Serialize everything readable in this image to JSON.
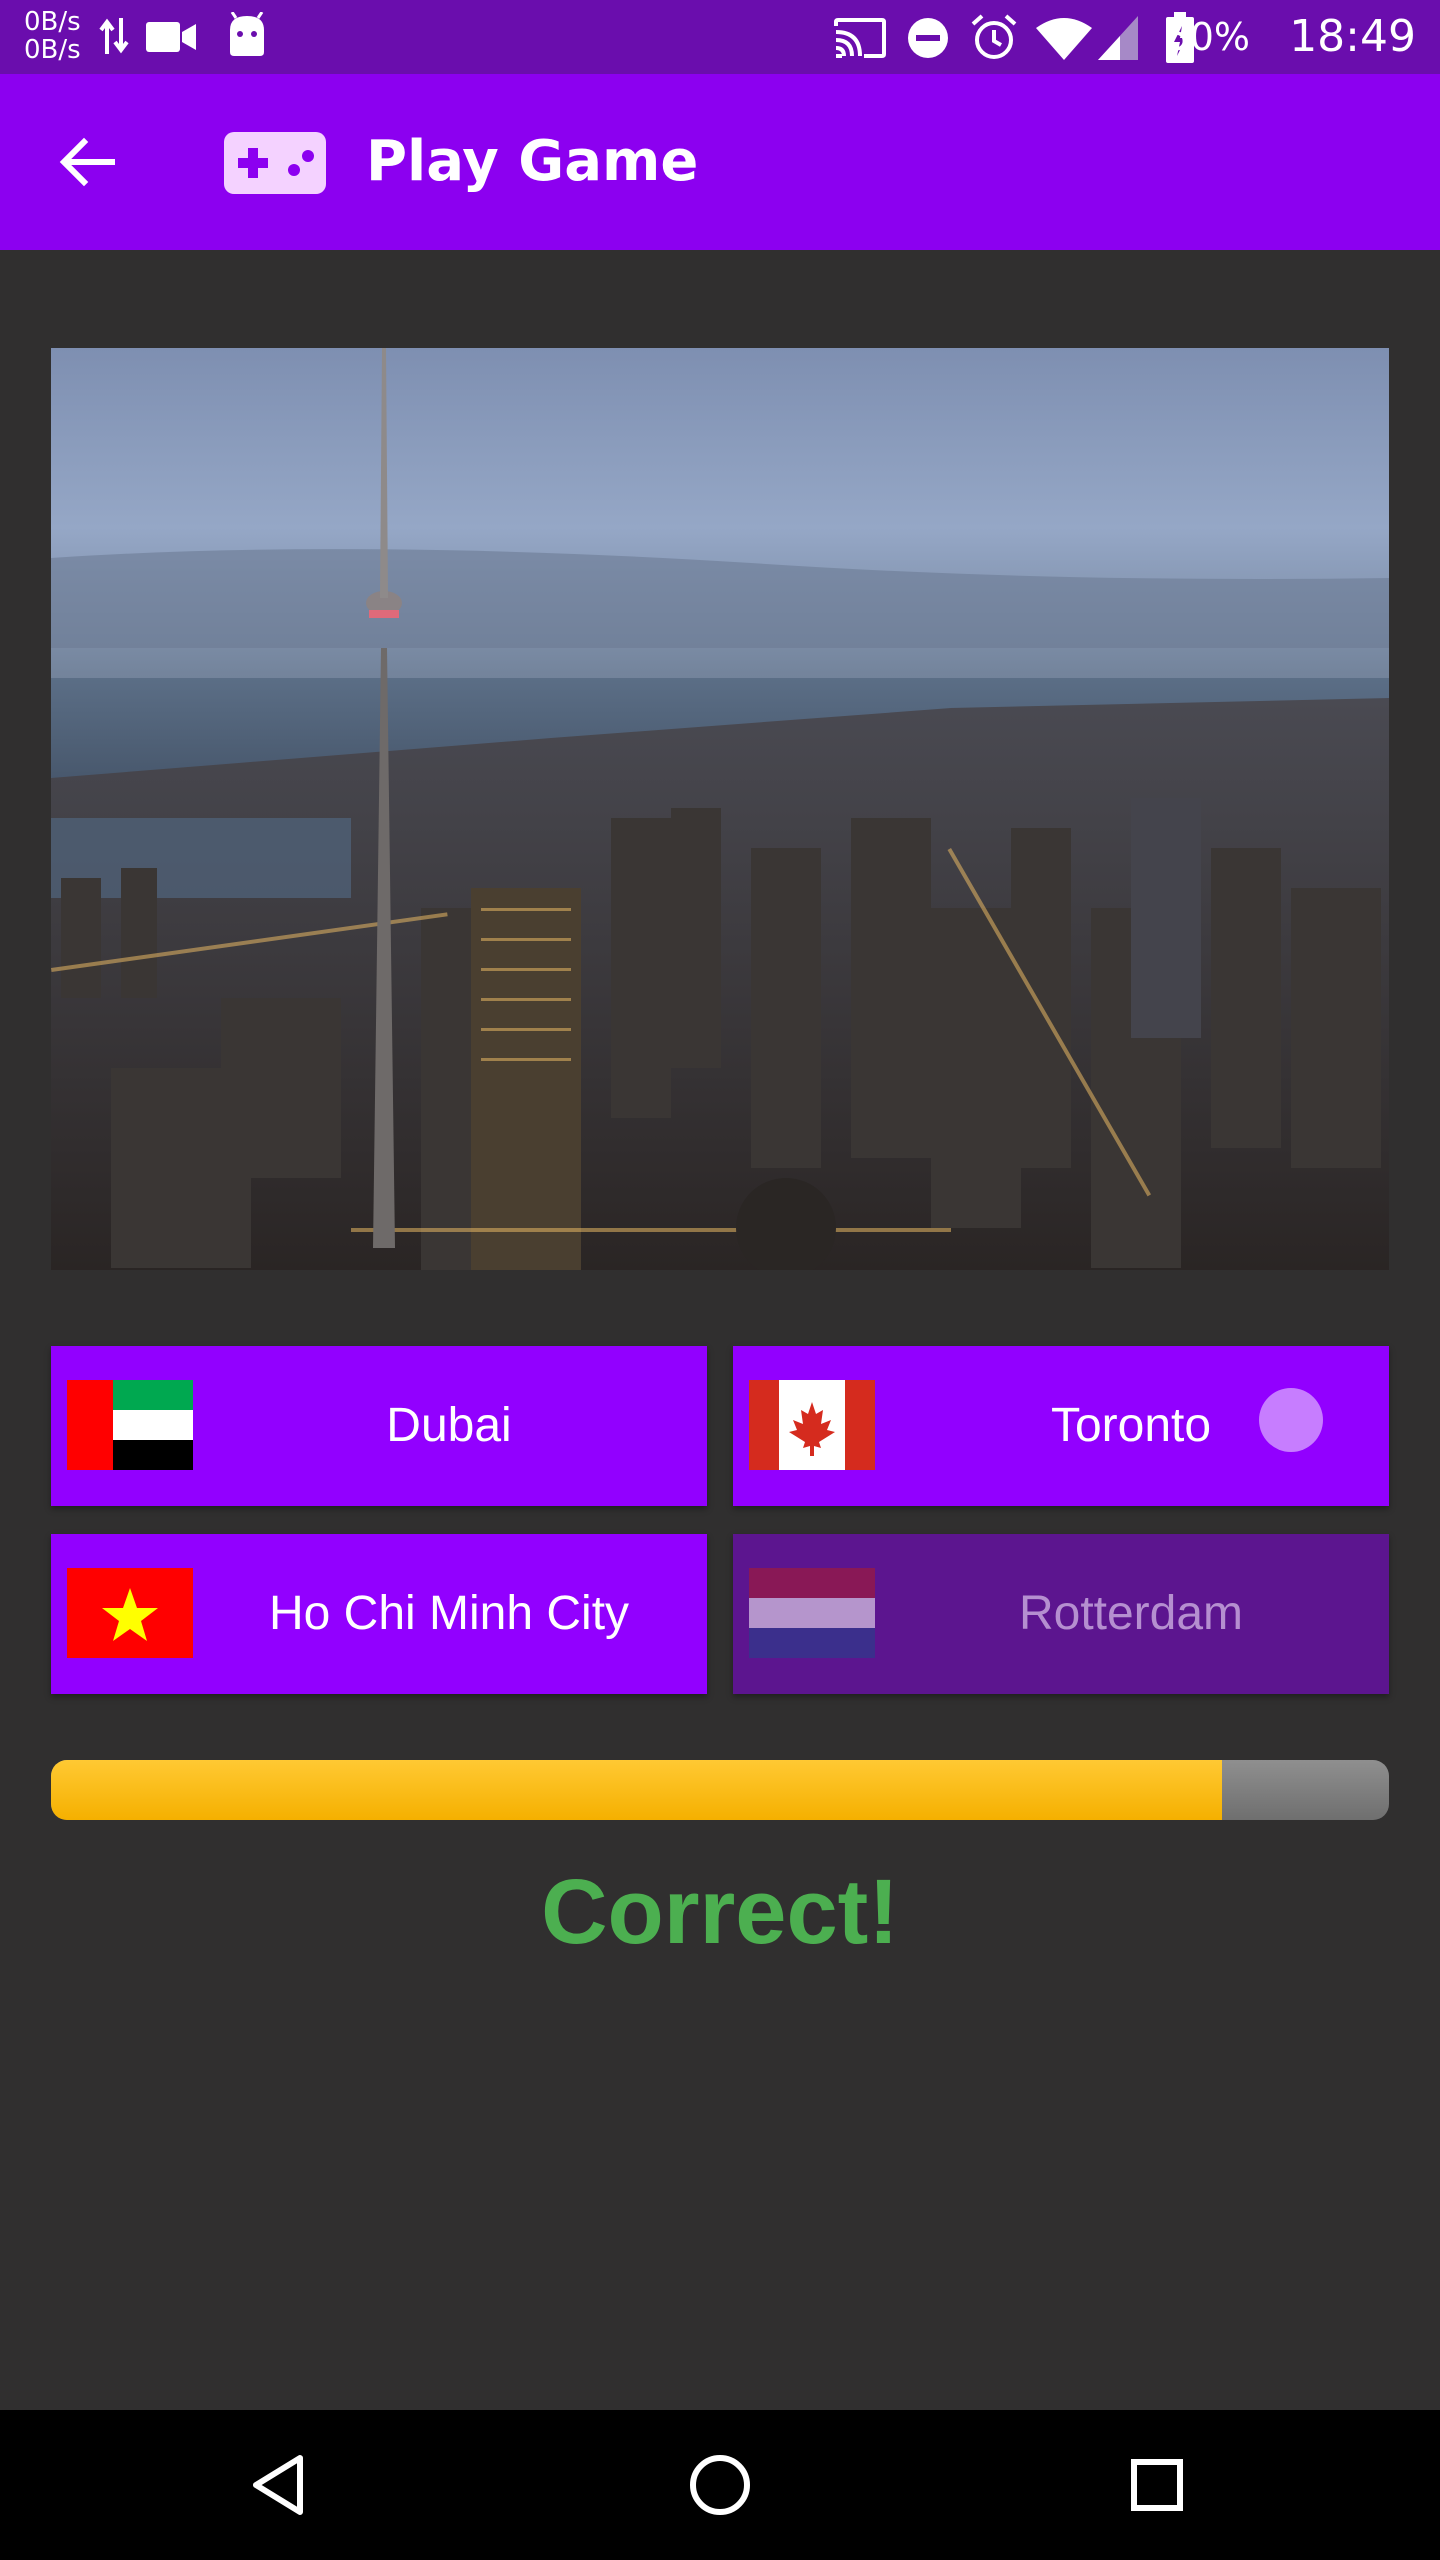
{
  "status_bar": {
    "net_up": "0B/s",
    "net_down": "0B/s",
    "battery": "50%",
    "time": "18:49",
    "icons": [
      "data-transfer-icon",
      "video-icon",
      "android-icon",
      "cast-icon",
      "do-not-disturb-icon",
      "alarm-icon",
      "wifi-icon",
      "signal-icon",
      "battery-icon"
    ]
  },
  "app_bar": {
    "title": "Play Game",
    "back_icon": "arrow-left-icon",
    "title_icon": "gamepad-icon"
  },
  "answers": [
    {
      "label": "Dubai",
      "flag": "united-arab-emirates-flag",
      "state": "enabled"
    },
    {
      "label": "Toronto",
      "flag": "canada-flag",
      "state": "pressed"
    },
    {
      "label": "Ho Chi Minh City",
      "flag": "vietnam-flag",
      "state": "enabled"
    },
    {
      "label": "Rotterdam",
      "flag": "netherlands-flag",
      "state": "disabled"
    }
  ],
  "progress": {
    "fraction": 0.875
  },
  "result_text": "Correct!",
  "colors": {
    "accent": "#8c00f0",
    "button": "#9200ff",
    "button_disabled": "#5c158f",
    "progress": "#ffc107",
    "success": "#4caf50",
    "background": "#302f2f"
  }
}
